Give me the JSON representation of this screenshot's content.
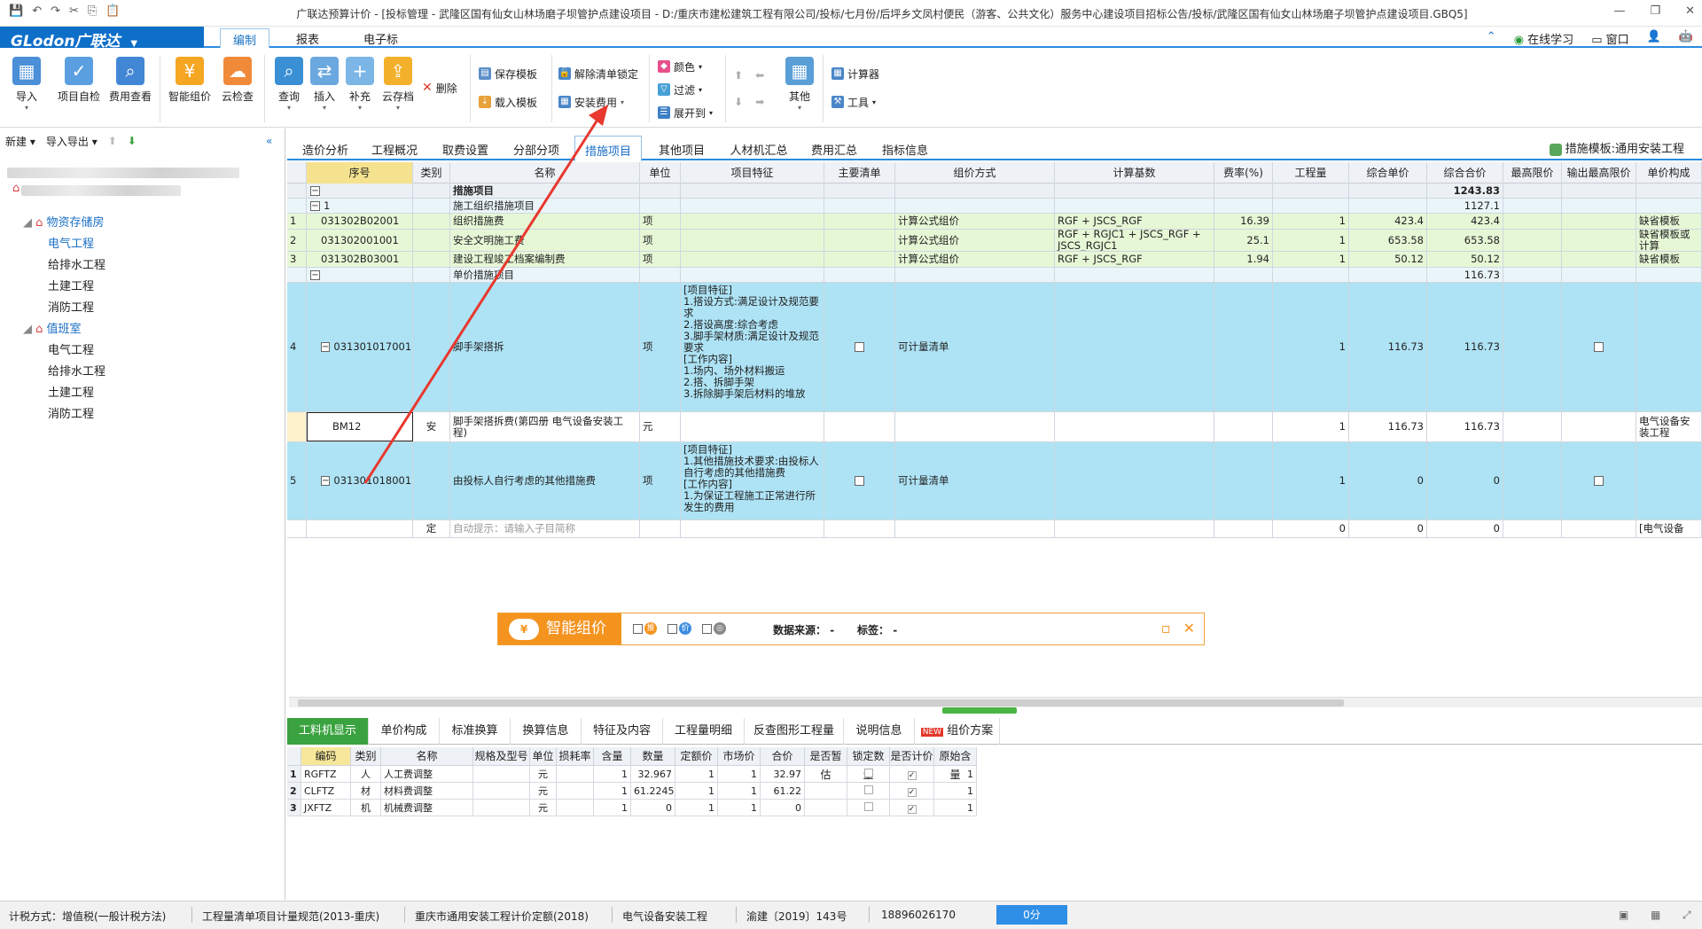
{
  "app": {
    "title": "广联达预算计价 - [投标管理 - 武隆区国有仙女山林场磨子坝管护点建设项目 - D:/重庆市建松建筑工程有限公司/投标/七月份/后坪乡文凤村便民（游客、公共文化）服务中心建设项目招标公告/投标/武隆区国有仙女山林场磨子坝管护点建设项目.GBQ5]",
    "logo": "GLodon广联达"
  },
  "menu": {
    "tabs": [
      "编制",
      "报表",
      "电子标"
    ],
    "right": [
      "在线学习",
      "窗口"
    ]
  },
  "ribbon": {
    "big_buttons": [
      "导入",
      "项目自检",
      "费用查看",
      "智能组价",
      "云检查",
      "查询",
      "插入",
      "补充",
      "云存档"
    ],
    "delete": "删除",
    "save_tpl": "保存模板",
    "load_tpl": "载入模板",
    "unlock": "解除清单锁定",
    "install_fee": "安装费用",
    "color": "颜色",
    "filter": "过滤",
    "expand_to": "展开到",
    "other": "其他",
    "calculator": "计算器",
    "tools": "工具"
  },
  "left": {
    "new": "新建",
    "import_export": "导入导出",
    "tree": [
      {
        "label": "物资存储房",
        "level": 1
      },
      {
        "label": "电气工程",
        "level": 2,
        "selected": true
      },
      {
        "label": "给排水工程",
        "level": 2
      },
      {
        "label": "土建工程",
        "level": 2
      },
      {
        "label": "消防工程",
        "level": 2
      },
      {
        "label": "值班室",
        "level": 1
      },
      {
        "label": "电气工程",
        "level": 2
      },
      {
        "label": "给排水工程",
        "level": 2
      },
      {
        "label": "土建工程",
        "level": 2
      },
      {
        "label": "消防工程",
        "level": 2
      }
    ]
  },
  "tabs": [
    "造价分析",
    "工程概况",
    "取费设置",
    "分部分项",
    "措施项目",
    "其他项目",
    "人材机汇总",
    "费用汇总",
    "指标信息"
  ],
  "active_tab": 4,
  "template": "措施模板:通用安装工程",
  "grid": {
    "headers": [
      "序号",
      "类别",
      "名称",
      "单位",
      "项目特征",
      "主要清单",
      "组价方式",
      "计算基数",
      "费率(%)",
      "工程量",
      "综合单价",
      "综合合价",
      "最高限价",
      "输出最高限价",
      "单价构成"
    ],
    "rows": [
      {
        "no": "",
        "code": "",
        "type": "",
        "name": "措施项目",
        "unit": "",
        "feat": "",
        "main": "",
        "method": "",
        "base": "",
        "rate": "",
        "qty": "",
        "price": "",
        "total": "1243.83",
        "last": ""
      },
      {
        "no": "",
        "code": "1",
        "type": "",
        "name": "施工组织措施项目",
        "unit": "",
        "feat": "",
        "main": "",
        "method": "",
        "base": "",
        "rate": "",
        "qty": "",
        "price": "",
        "total": "1127.1",
        "last": ""
      },
      {
        "no": "1",
        "code": "031302B02001",
        "type": "",
        "name": "组织措施费",
        "unit": "项",
        "feat": "",
        "main": "",
        "method": "计算公式组价",
        "base": "RGF + JSCS_RGF",
        "rate": "16.39",
        "qty": "1",
        "price": "423.4",
        "total": "423.4",
        "last": "缺省模板"
      },
      {
        "no": "2",
        "code": "031302001001",
        "type": "",
        "name": "安全文明施工费",
        "unit": "项",
        "feat": "",
        "main": "",
        "method": "计算公式组价",
        "base": "RGF + RGJC1 + JSCS_RGF + JSCS_RGJC1",
        "rate": "25.1",
        "qty": "1",
        "price": "653.58",
        "total": "653.58",
        "last": "缺省模板或计算"
      },
      {
        "no": "3",
        "code": "031302B03001",
        "type": "",
        "name": "建设工程竣工档案编制费",
        "unit": "项",
        "feat": "",
        "main": "",
        "method": "计算公式组价",
        "base": "RGF + JSCS_RGF",
        "rate": "1.94",
        "qty": "1",
        "price": "50.12",
        "total": "50.12",
        "last": "缺省模板"
      },
      {
        "no": "",
        "code": "",
        "type": "",
        "name": "单价措施项目",
        "unit": "",
        "feat": "",
        "main": "",
        "method": "",
        "base": "",
        "rate": "",
        "qty": "",
        "price": "",
        "total": "116.73",
        "last": ""
      },
      {
        "no": "4",
        "code": "031301017001",
        "type": "",
        "name": "脚手架搭拆",
        "unit": "项",
        "feat": "[项目特征]\n1.搭设方式:满足设计及规范要求\n2.搭设高度:综合考虑\n3.脚手架材质:满足设计及规范要求\n[工作内容]\n1.场内、场外材料搬运\n2.搭、拆脚手架\n3.拆除脚手架后材料的堆放",
        "main": "box",
        "method": "可计量清单",
        "base": "",
        "rate": "",
        "qty": "1",
        "price": "116.73",
        "total": "116.73",
        "last": ""
      },
      {
        "no": "",
        "code": "BM12",
        "type": "安",
        "name": "脚手架搭拆费(第四册 电气设备安装工程)",
        "unit": "元",
        "feat": "",
        "main": "",
        "method": "",
        "base": "",
        "rate": "",
        "qty": "1",
        "price": "116.73",
        "total": "116.73",
        "last": "电气设备安装工程"
      },
      {
        "no": "5",
        "code": "031301018001",
        "type": "",
        "name": "由投标人自行考虑的其他措施费",
        "unit": "项",
        "feat": "[项目特征]\n1.其他措施技术要求:由投标人自行考虑的其他措施费\n[工作内容]\n1.为保证工程施工正常进行所发生的费用",
        "main": "box",
        "method": "可计量清单",
        "base": "",
        "rate": "",
        "qty": "1",
        "price": "0",
        "total": "0",
        "last": ""
      },
      {
        "no": "",
        "code": "",
        "type": "定",
        "name": "自动提示：请输入子目简称",
        "unit": "",
        "feat": "",
        "main": "",
        "method": "",
        "base": "",
        "rate": "",
        "qty": "0",
        "price": "0",
        "total": "0",
        "last": "[电气设备"
      }
    ]
  },
  "smart": {
    "label": "智能组价",
    "source_label": "数据来源：",
    "source_value": "-",
    "tag_label": "标签：",
    "tag_value": "-"
  },
  "bottom_tabs": [
    "工料机显示",
    "单价构成",
    "标准换算",
    "换算信息",
    "特征及内容",
    "工程量明细",
    "反查图形工程量",
    "说明信息",
    "组价方案"
  ],
  "lower_grid": {
    "headers": [
      "编码",
      "类别",
      "名称",
      "规格及型号",
      "单位",
      "损耗率",
      "含量",
      "数量",
      "定额价",
      "市场价",
      "合价",
      "是否暂估",
      "锁定数量",
      "是否计价",
      "原始含量"
    ],
    "rows": [
      [
        "1",
        "RGFTZ",
        "人",
        "人工费调整",
        "",
        "元",
        "",
        "1",
        "32.967",
        "1",
        "1",
        "32.97",
        "",
        "",
        "checked",
        "1"
      ],
      [
        "2",
        "CLFTZ",
        "材",
        "材料费调整",
        "",
        "元",
        "",
        "1",
        "61.2245",
        "1",
        "1",
        "61.22",
        "",
        "",
        "checked",
        "1"
      ],
      [
        "3",
        "JXFTZ",
        "机",
        "机械费调整",
        "",
        "元",
        "",
        "1",
        "0",
        "1",
        "1",
        "0",
        "",
        "",
        "checked",
        "1"
      ]
    ]
  },
  "status": [
    "计税方式：增值税(一般计税方法)",
    "工程量清单项目计量规范(2013-重庆)",
    "重庆市通用安装工程计价定额(2018)",
    "电气设备安装工程",
    "渝建〔2019〕143号",
    "18896026170",
    "0分"
  ],
  "colors": {
    "accent": "#2a8be0",
    "rowGreen": "#e6f7d6",
    "rowBlue": "#aee3f5",
    "rowGroup": "#eaf3f7",
    "smartOrange": "#f5931f",
    "arrow": "#e8382f"
  }
}
